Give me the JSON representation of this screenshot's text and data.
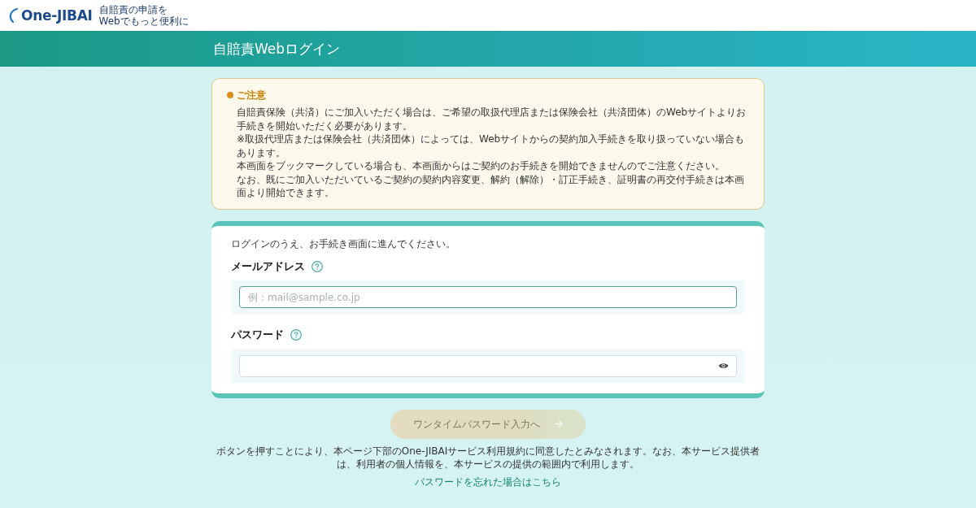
{
  "header": {
    "logo": "One-JIBAI",
    "tagline": [
      "自賠責の申請を",
      "Webでもっと便利に"
    ]
  },
  "banner": {
    "title": "自賠責Webログイン"
  },
  "notice": {
    "title": "ご注意",
    "paragraphs": [
      "自賠責保険（共済）にご加入いただく場合は、ご希望の取扱代理店または保険会社（共済団体）のWebサイトよりお手続きを開始いただく必要があります。",
      "※取扱代理店または保険会社（共済団体）によっては、Webサイトからの契約加入手続きを取り扱っていない場合もあります。",
      "本画面をブックマークしている場合も、本画面からはご契約のお手続きを開始できませんのでご注意ください。",
      "なお、既にご加入いただいているご契約の契約内容変更、解約（解除）・訂正手続き、証明書の再交付手続きは本画面より開始できます。"
    ]
  },
  "login_form": {
    "intro": "ログインのうえ、お手続き画面に進んでください。",
    "fields": [
      {
        "kind": "email",
        "label": "メールアドレス",
        "placeholder": "例：mail@sample.co.jp",
        "focused": true
      },
      {
        "kind": "password",
        "label": "パスワード",
        "focused": false
      }
    ]
  },
  "submit_button": {
    "label": "ワンタイムパスワード入力へ",
    "disabled": true
  },
  "consent_text": "ボタンを押すことにより、本ページ下部のOne-JIBAIサービス利用規約に同意したとみなされます。なお、本サービス提供者は、利用者の個人情報を、本サービスの提供の範囲内で利用します。",
  "forgot_password_link": "パスワードを忘れた場合はこちら"
}
